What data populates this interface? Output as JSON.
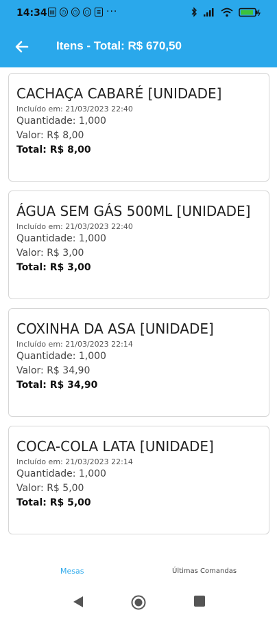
{
  "status_bar": {
    "time": "14:34",
    "more": "···",
    "battery_level": 0.9
  },
  "header": {
    "title": "Itens - Total: R$ 670,50"
  },
  "items": [
    {
      "name": "CACHAÇA CABARÉ [UNIDADE]",
      "date": "Incluído em: 21/03/2023 22:40",
      "quantity": "Quantidade: 1,000",
      "value": "Valor: R$ 8,00",
      "total": "Total: R$ 8,00"
    },
    {
      "name": "ÁGUA SEM GÁS 500ML [UNIDADE]",
      "date": "Incluído em: 21/03/2023 22:40",
      "quantity": "Quantidade: 1,000",
      "value": "Valor: R$ 3,00",
      "total": "Total: R$ 3,00"
    },
    {
      "name": "COXINHA DA ASA [UNIDADE]",
      "date": "Incluído em: 21/03/2023 22:14",
      "quantity": "Quantidade: 1,000",
      "value": "Valor: R$ 34,90",
      "total": "Total: R$ 34,90"
    },
    {
      "name": "COCA-COLA LATA [UNIDADE]",
      "date": "Incluído em: 21/03/2023 22:14",
      "quantity": "Quantidade: 1,000",
      "value": "Valor: R$ 5,00",
      "total": "Total: R$ 5,00"
    }
  ],
  "bottom_nav": {
    "tab_mesas": "Mesas",
    "tab_ultimas": "Últimas Comandas"
  },
  "colors": {
    "accent": "#2aa8eb"
  }
}
